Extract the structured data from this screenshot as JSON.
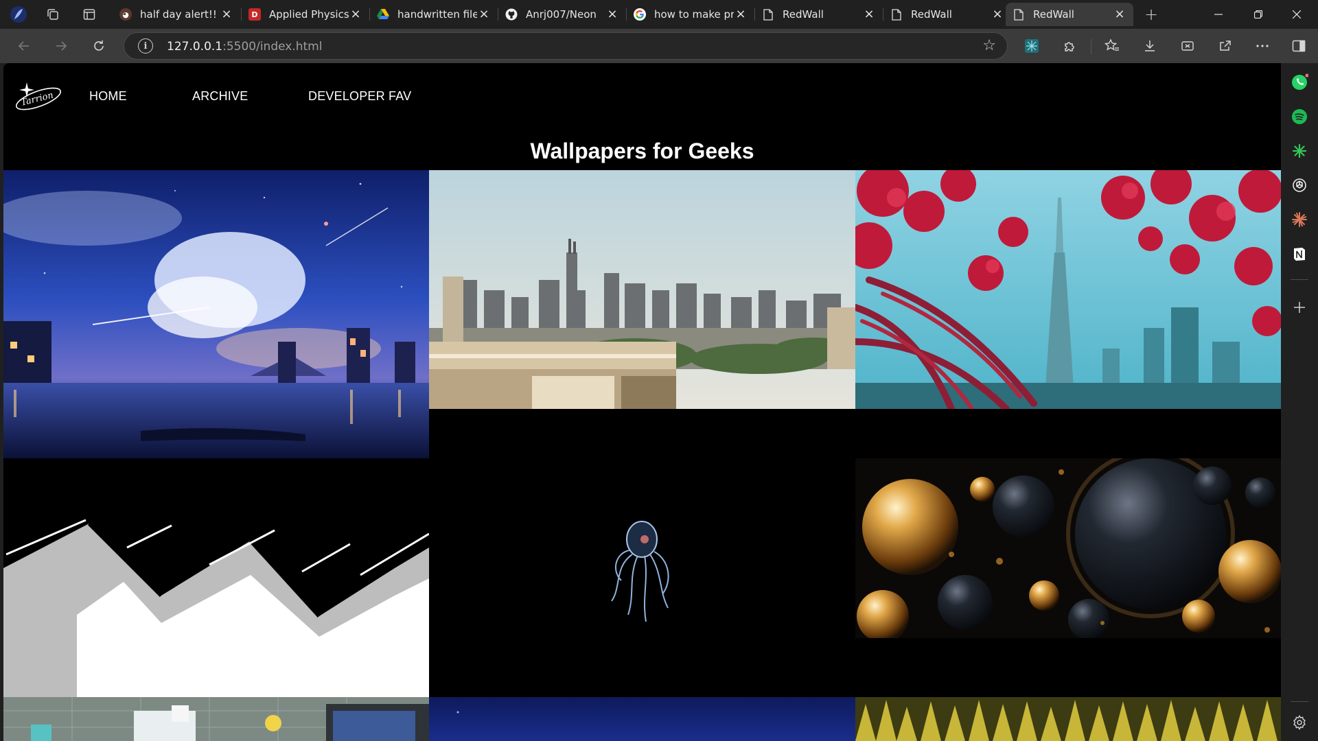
{
  "browser": {
    "tabs": [
      {
        "title": "half day alert!! : r",
        "favicon": "reddit-avatar-icon",
        "active": false
      },
      {
        "title": "Applied Physics |",
        "favicon": "pdf-icon",
        "active": false
      },
      {
        "title": "handwritten file",
        "favicon": "google-drive-icon",
        "active": false
      },
      {
        "title": "Anrj007/Neon",
        "favicon": "github-icon",
        "active": false
      },
      {
        "title": "how to make pri",
        "favicon": "google-icon",
        "active": false
      },
      {
        "title": "RedWall",
        "favicon": "document-icon",
        "active": false
      },
      {
        "title": "RedWall",
        "favicon": "document-icon",
        "active": false
      },
      {
        "title": "RedWall",
        "favicon": "document-icon",
        "active": true
      }
    ],
    "url_host": "127.0.0.1",
    "url_rest": ":5500/index.html",
    "sidebar_icons": [
      "whatsapp-icon",
      "spotify-icon",
      "perplexity-icon",
      "chatgpt-icon",
      "claude-icon",
      "notion-icon",
      "add-icon",
      "settings-icon"
    ],
    "colors": {
      "chrome_dark": "#202020",
      "chrome_toolbar": "#3b3b3b",
      "page_bg": "#000000"
    }
  },
  "site": {
    "logo_text": "Tarrion",
    "nav": {
      "home": "HOME",
      "archive": "ARCHIVE",
      "developer_fav": "DEVELOPER FAV"
    },
    "title": "Wallpapers for Geeks",
    "wallpapers": [
      "anime-night-sky-lake",
      "city-skyline",
      "red-flowers-skyscraper",
      "black-white-zigzag",
      "deep-sea-octopus",
      "golden-black-spheres",
      "isometric-desk",
      "dark-blue-sky",
      "golden-forest"
    ]
  }
}
